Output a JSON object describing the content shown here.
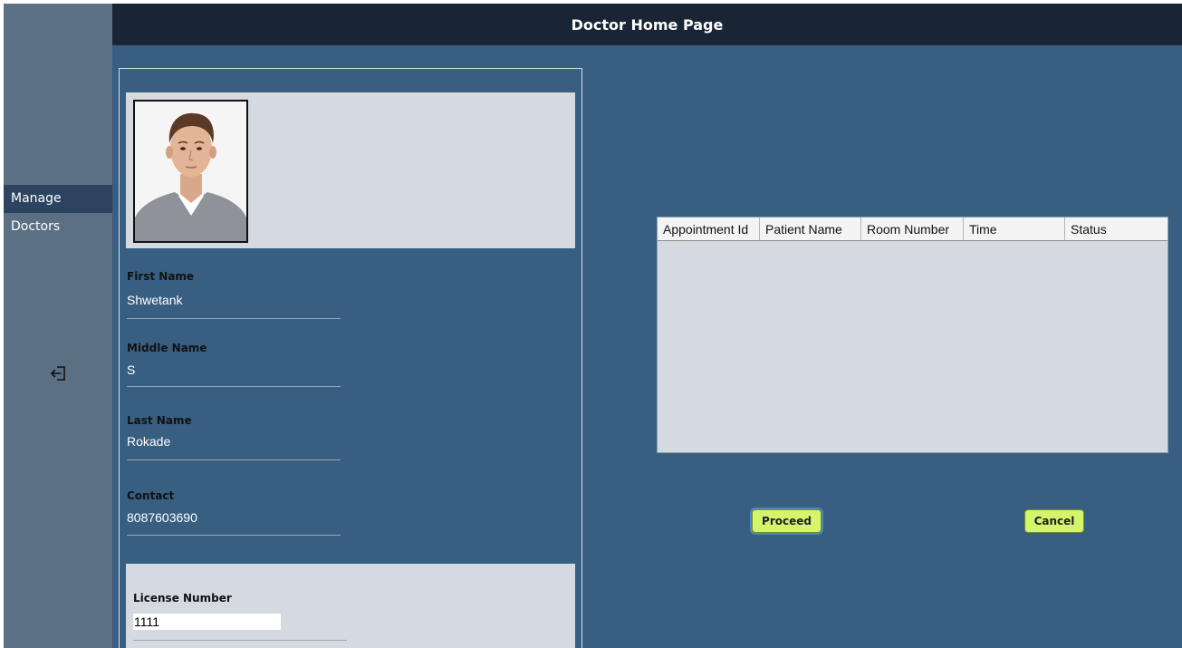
{
  "header": {
    "title": "Doctor Home Page"
  },
  "sidebar": {
    "manage_doctors_label": "Manage Doctors",
    "logout_icon": "logout-icon"
  },
  "profile": {
    "photo_icon": "doctor-photo",
    "first_name": {
      "label": "First Name",
      "value": "Shwetank"
    },
    "middle_name": {
      "label": "Middle Name",
      "value": "S"
    },
    "last_name": {
      "label": "Last Name",
      "value": "Rokade"
    },
    "contact": {
      "label": "Contact",
      "value": "8087603690"
    },
    "license": {
      "label": "License Number",
      "value": "1111"
    }
  },
  "appointments": {
    "columns": [
      "Appointment Id",
      "Patient Name",
      "Room Number",
      "Time",
      "Status"
    ],
    "rows": []
  },
  "actions": {
    "proceed_label": "Proceed",
    "cancel_label": "Cancel"
  },
  "colors": {
    "header_bg": "#192435",
    "main_bg": "#385f81",
    "sidebar_bg": "#5b7083",
    "button_bg": "#d4f56a"
  }
}
